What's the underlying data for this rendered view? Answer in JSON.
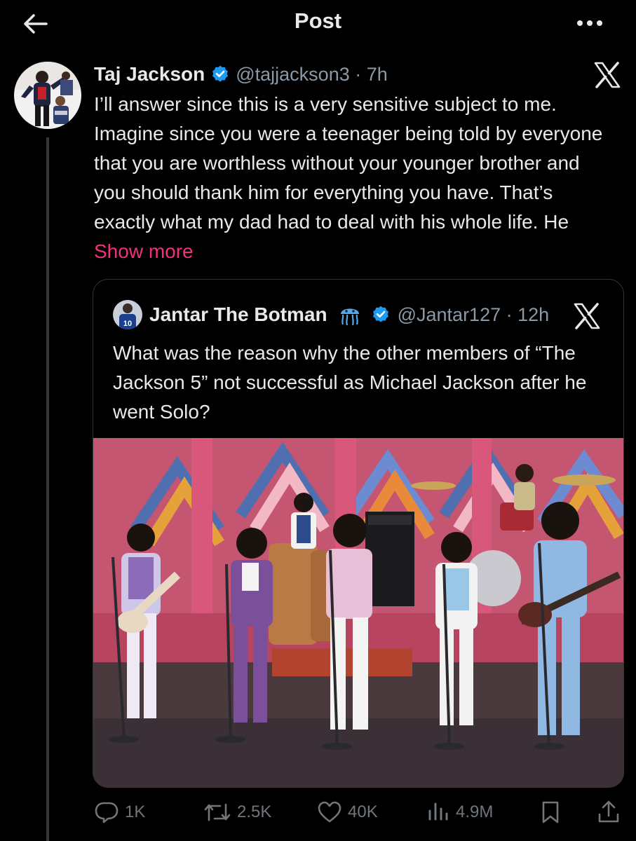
{
  "header": {
    "title": "Post"
  },
  "post": {
    "author_name": "Taj Jackson",
    "handle_time": "@tajjackson3 · 7h",
    "text": "I’ll answer since this is a very sensitive subject to me. Imagine since you were a teenager being told by everyone that you are worthless without your younger brother and you should thank him for everything you have. That’s exactly what my dad had to deal with his whole life. He ",
    "show_more": "Show more"
  },
  "quote": {
    "author_name": "Jantar The Botman",
    "handle_time": "@Jantar127 · 12h",
    "text": "What was the reason why the other members of “The Jackson 5” not successful as Michael Jackson after he went Solo?",
    "avatar_number": "10"
  },
  "actions": {
    "replies": "1K",
    "reposts": "2.5K",
    "likes": "40K",
    "views": "4.9M"
  },
  "colors": {
    "background": "#000000",
    "text": "#e7e9ea",
    "secondary": "#8b98a5",
    "accent_link": "#f2317b",
    "verified": "#1d9bf0",
    "border": "#333639"
  },
  "icons": [
    "back-arrow-icon",
    "more-dots-icon",
    "verified-badge-icon",
    "x-logo-icon",
    "jellyfish-icon",
    "reply-icon",
    "repost-icon",
    "like-icon",
    "views-icon",
    "bookmark-icon",
    "share-icon"
  ]
}
